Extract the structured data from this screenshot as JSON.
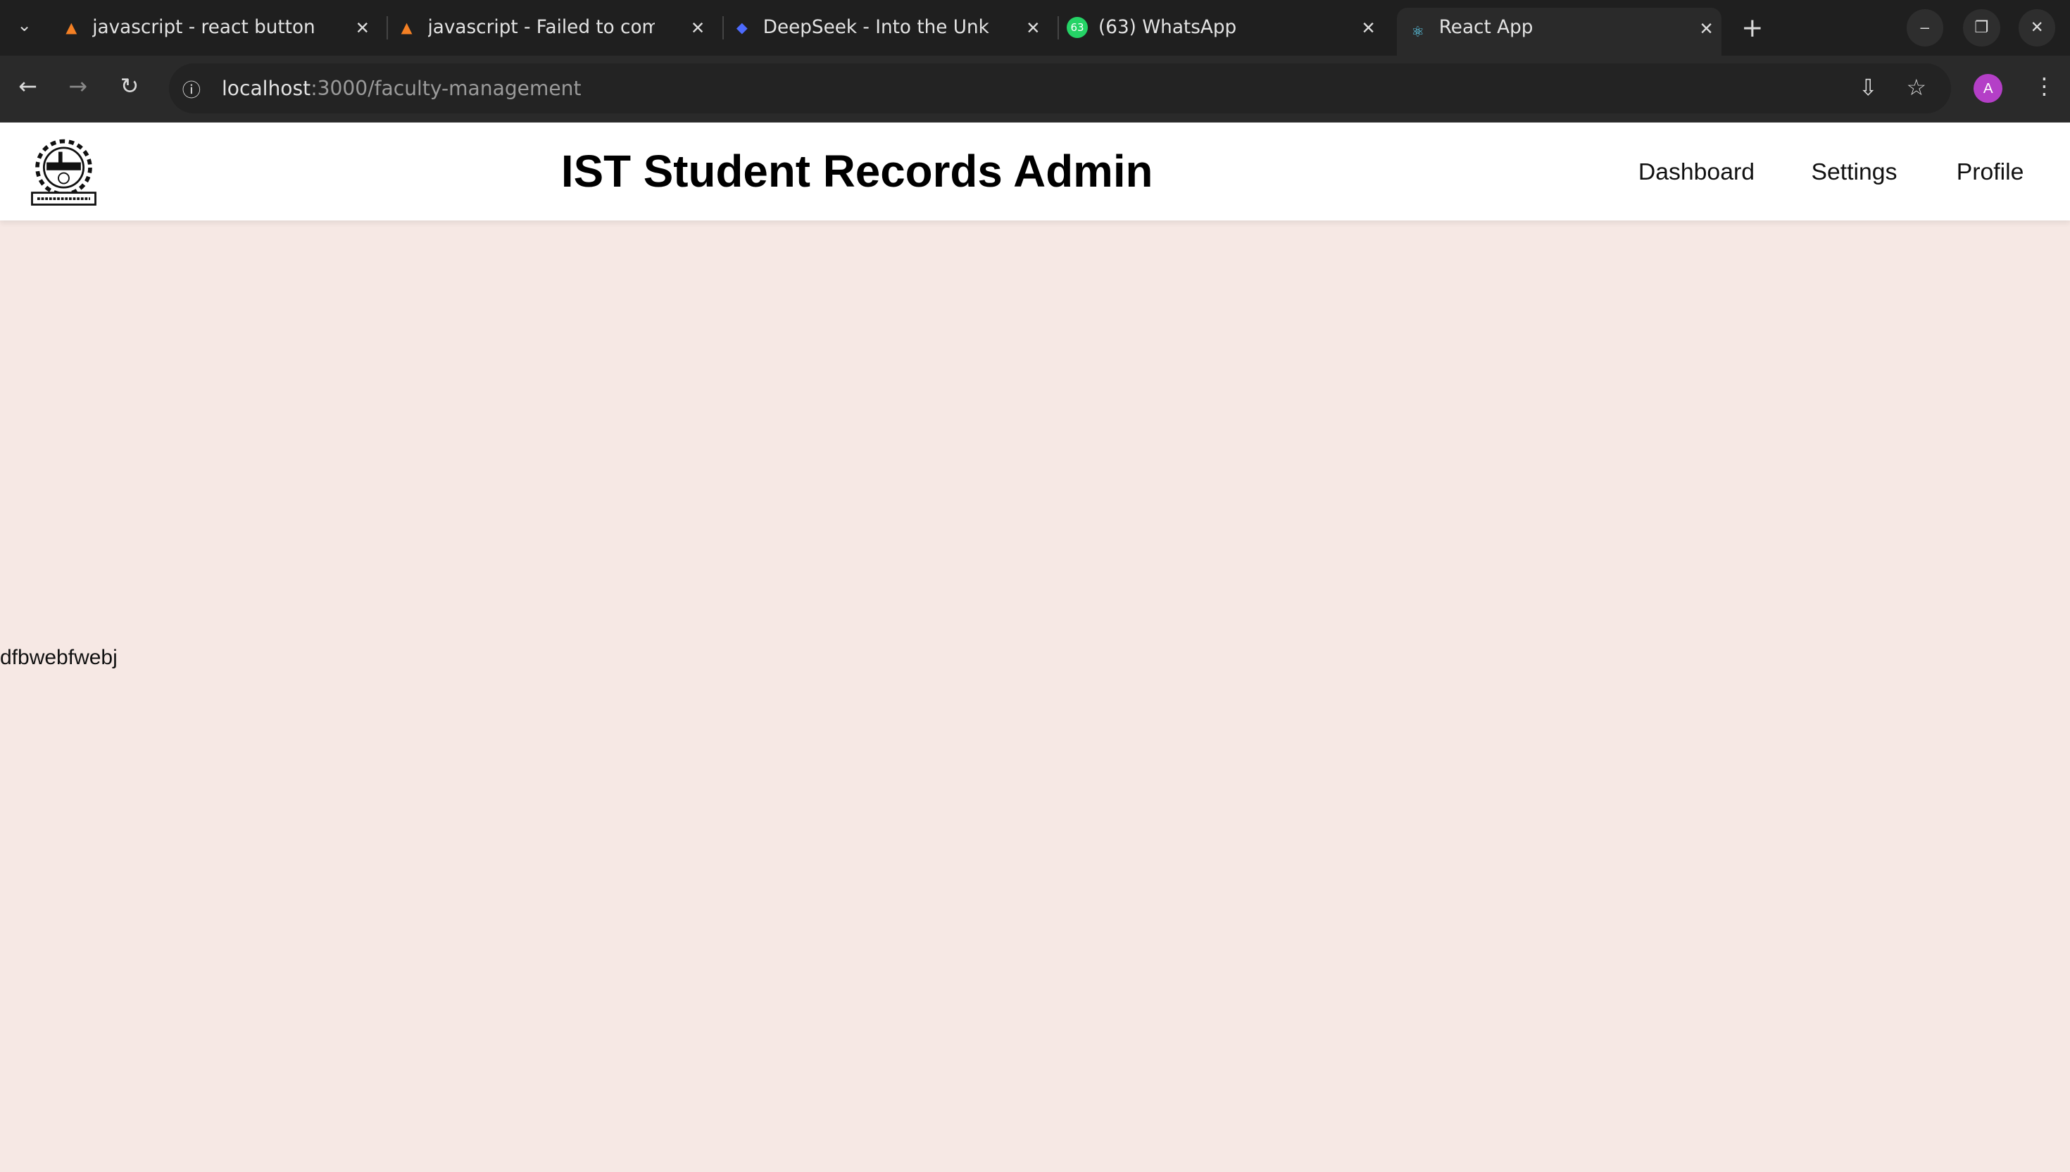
{
  "browser": {
    "tabs": [
      {
        "title": "javascript - react button c",
        "icon": "stackoverflow-icon"
      },
      {
        "title": "javascript - Failed to com",
        "icon": "stackoverflow-icon"
      },
      {
        "title": "DeepSeek - Into the Unkn",
        "icon": "deepseek-icon"
      },
      {
        "title": "(63) WhatsApp",
        "icon": "whatsapp-icon"
      },
      {
        "title": "React App",
        "icon": "react-icon",
        "active": true
      }
    ],
    "close_glyph": "✕",
    "new_tab": "+",
    "url_host": "localhost",
    "url_rest": ":3000/faculty-management",
    "avatar_letter": "A",
    "avatar_color": "#b43fc7"
  },
  "header": {
    "title": "IST Student Records Admin",
    "nav": [
      "Dashboard",
      "Settings",
      "Profile"
    ]
  },
  "content": {
    "text": "dfbwebfwebj"
  },
  "colors": {
    "background": "#f6e8e4"
  }
}
